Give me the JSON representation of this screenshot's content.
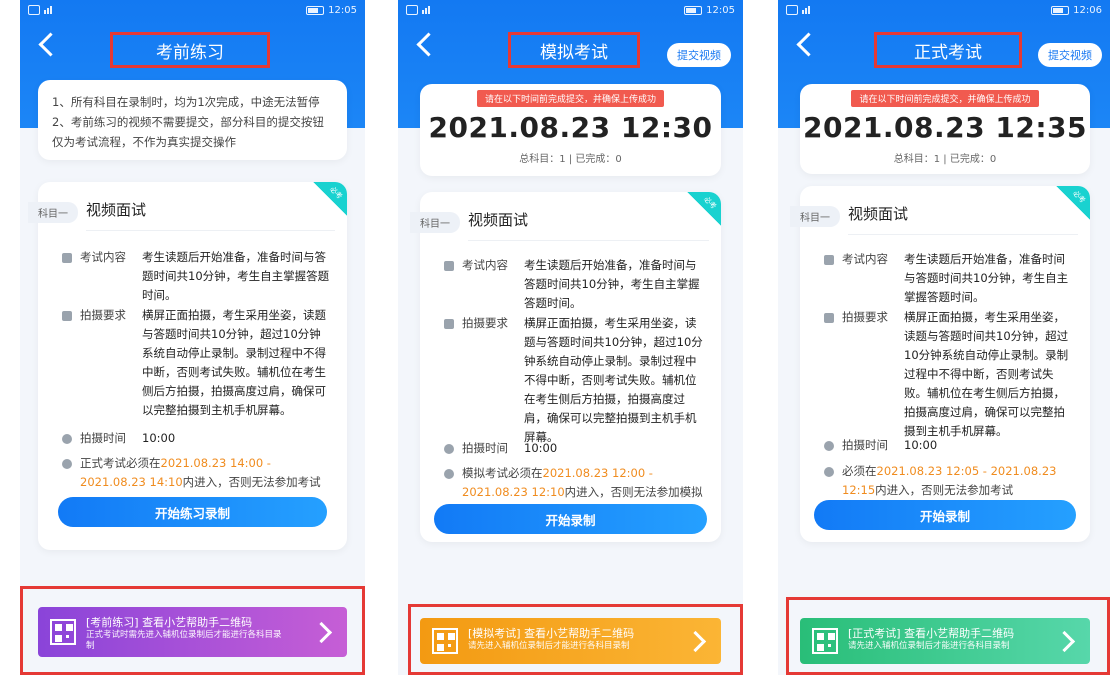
{
  "status": {
    "time1": "12:05",
    "time2": "12:05",
    "time3": "12:06"
  },
  "screens": [
    {
      "title": "考前练习",
      "notice": [
        "1、所有科目在录制时，均为1次完成，中途无法暂停",
        "2、考前练习的视频不需要提交，部分科目的提交按钮仅为考试流程，不作为真实提交操作"
      ],
      "subject_tag": "科目一",
      "subject_name": "视频面试",
      "corner": "必考",
      "content_label": "考试内容",
      "content_value": "考生读题后开始准备，准备时间与答题时间共10分钟，考生自主掌握答题时间。",
      "shoot_label": "拍摄要求",
      "shoot_value": "横屏正面拍摄，考生采用坐姿，读题与答题时间共10分钟，超过10分钟系统自动停止录制。录制过程中不得中断，否则考试失败。辅机位在考生侧后方拍摄，拍摄高度过肩，确保可以完整拍摄到主机手机屏幕。",
      "time_label": "拍摄时间",
      "time_value": "10:00",
      "warning_pre": "正式考试必须在",
      "warning_time": "2021.08.23 14:00 - 2021.08.23 14:10",
      "warning_post": "内进入，否则无法参加考试",
      "action": "开始练习录制",
      "qr_title": "[考前练习] 查看小艺帮助手二维码",
      "qr_sub": "正式考试时需先进入辅机位录制后才能进行各科目录制"
    },
    {
      "title": "模拟考试",
      "submit": "提交视频",
      "deadline_tip": "请在以下时间前完成提交，并确保上传成功",
      "deadline_time": "2021.08.23 12:30",
      "deadline_count": "总科目：1 | 已完成：0",
      "subject_tag": "科目一",
      "subject_name": "视频面试",
      "corner": "必考",
      "content_label": "考试内容",
      "content_value": "考生读题后开始准备，准备时间与答题时间共10分钟，考生自主掌握答题时间。",
      "shoot_label": "拍摄要求",
      "shoot_value": "横屏正面拍摄，考生采用坐姿，读题与答题时间共10分钟，超过10分钟系统自动停止录制。录制过程中不得中断，否则考试失败。辅机位在考生侧后方拍摄，拍摄高度过肩，确保可以完整拍摄到主机手机屏幕。",
      "time_label": "拍摄时间",
      "time_value": "10:00",
      "warning_pre": "模拟考试必须在",
      "warning_time": "2021.08.23 12:00 - 2021.08.23 12:10",
      "warning_post": "内进入，否则无法参加模拟考试",
      "action": "开始录制",
      "qr_title": "[模拟考试] 查看小艺帮助手二维码",
      "qr_sub": "请先进入辅机位录制后才能进行各科目录制"
    },
    {
      "title": "正式考试",
      "submit": "提交视频",
      "deadline_tip": "请在以下时间前完成提交，并确保上传成功",
      "deadline_time": "2021.08.23 12:35",
      "deadline_count": "总科目：1 | 已完成：0",
      "subject_tag": "科目一",
      "subject_name": "视频面试",
      "corner": "必考",
      "content_label": "考试内容",
      "content_value": "考生读题后开始准备，准备时间与答题时间共10分钟，考生自主掌握答题时间。",
      "shoot_label": "拍摄要求",
      "shoot_value": "横屏正面拍摄，考生采用坐姿，读题与答题时间共10分钟，超过10分钟系统自动停止录制。录制过程中不得中断，否则考试失败。辅机位在考生侧后方拍摄，拍摄高度过肩，确保可以完整拍摄到主机手机屏幕。",
      "time_label": "拍摄时间",
      "time_value": "10:00",
      "warning_pre": "必须在",
      "warning_time": "2021.08.23 12:05 - 2021.08.23 12:15",
      "warning_post": "内进入，否则无法参加考试",
      "action": "开始录制",
      "qr_title": "[正式考试] 查看小艺帮助手二维码",
      "qr_sub": "请先进入辅机位录制后才能进行各科目录制"
    }
  ],
  "colors": {
    "brand_blue": "#1677f2",
    "highlight_red": "#e53935",
    "time_orange": "#f08c1f",
    "qr_practice": "#a54bdc",
    "qr_mock": "#f6a21a",
    "qr_formal": "#35c58e"
  }
}
